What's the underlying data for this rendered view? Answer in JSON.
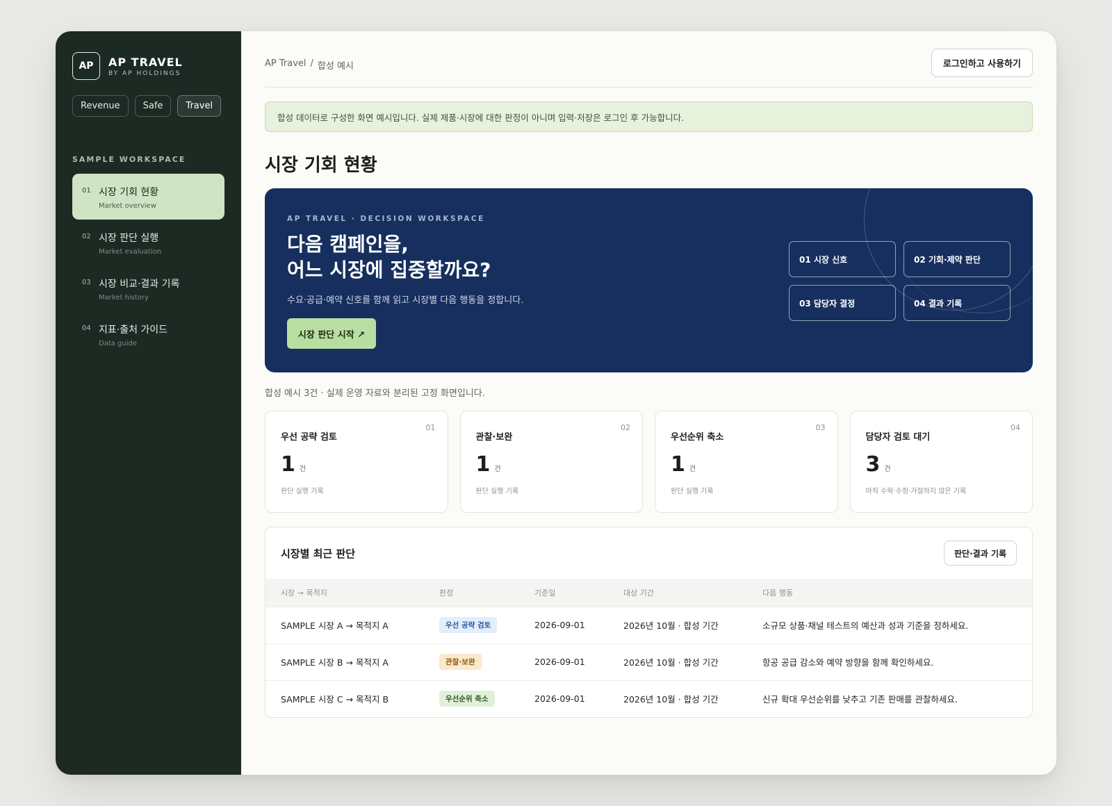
{
  "brand": {
    "badge": "AP",
    "name": "AP TRAVEL",
    "sub": "BY AP HOLDINGS"
  },
  "segments": [
    "Revenue",
    "Safe",
    "Travel"
  ],
  "workspace_label": "SAMPLE WORKSPACE",
  "nav": [
    {
      "num": "01",
      "title": "시장 기회 현황",
      "sub": "Market overview"
    },
    {
      "num": "02",
      "title": "시장 판단 실행",
      "sub": "Market evaluation"
    },
    {
      "num": "03",
      "title": "시장 비교·결과 기록",
      "sub": "Market history"
    },
    {
      "num": "04",
      "title": "지표·출처 가이드",
      "sub": "Data guide"
    }
  ],
  "breadcrumb": {
    "root": "AP Travel",
    "sep": "/",
    "current": "합성 예시"
  },
  "login_label": "로그인하고 사용하기",
  "notice": "합성 데이터로 구성한 화면 예시입니다. 실제 제품·시장에 대한 판정이 아니며 입력·저장은 로그인 후 가능합니다.",
  "page_title": "시장 기회 현황",
  "hero": {
    "kicker": "AP TRAVEL · DECISION WORKSPACE",
    "headline_1": "다음 캠페인을,",
    "headline_2": "어느 시장에 집중할까요?",
    "desc": "수요·공급·예약 신호를 함께 읽고 시장별 다음 행동을 정합니다.",
    "cta": "시장 판단 시작 ↗",
    "steps": [
      "01 시장 신호",
      "02 기회·제약 판단",
      "03 담당자 결정",
      "04 결과 기록"
    ]
  },
  "meta": "합성 예시 3건 · 실제 운영 자료와 분리된 고정 화면입니다.",
  "cards": [
    {
      "num": "01",
      "title": "우선 공략 검토",
      "value": "1",
      "unit": "건",
      "foot": "판단 실행 기록"
    },
    {
      "num": "02",
      "title": "관찰·보완",
      "value": "1",
      "unit": "건",
      "foot": "판단 실행 기록"
    },
    {
      "num": "03",
      "title": "우선순위 축소",
      "value": "1",
      "unit": "건",
      "foot": "판단 실행 기록"
    },
    {
      "num": "04",
      "title": "담당자 검토 대기",
      "value": "3",
      "unit": "건",
      "foot": "아직 수락·수정·거절하지 않은 기록"
    }
  ],
  "table": {
    "title": "시장별 최근 판단",
    "button": "판단·결과 기록",
    "columns": [
      "시장 → 목적지",
      "판정",
      "기준일",
      "대상 기간",
      "다음 행동"
    ],
    "rows": [
      {
        "market": "SAMPLE 시장 A → 목적지 A",
        "verdict": "우선 공략 검토",
        "date": "2026-09-01",
        "period": "2026년 10월 · 합성 기간",
        "action": "소규모 상품·채널 테스트의 예산과 성과 기준을 정하세요."
      },
      {
        "market": "SAMPLE 시장 B → 목적지 A",
        "verdict": "관찰·보완",
        "date": "2026-09-01",
        "period": "2026년 10월 · 합성 기간",
        "action": "항공 공급 감소와 예약 방향을 함께 확인하세요."
      },
      {
        "market": "SAMPLE 시장 C → 목적지 B",
        "verdict": "우선순위 축소",
        "date": "2026-09-01",
        "period": "2026년 10월 · 합성 기간",
        "action": "신규 확대 우선순위를 낮추고 기존 판매를 관찰하세요."
      }
    ]
  }
}
